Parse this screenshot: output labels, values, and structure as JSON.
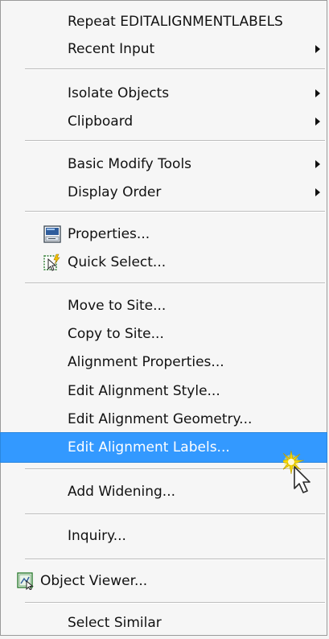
{
  "menu": {
    "items": [
      {
        "label": "Repeat EDITALIGNMENTLABELS"
      },
      {
        "label": "Recent Input"
      },
      {
        "label": "Isolate Objects"
      },
      {
        "label": "Clipboard"
      },
      {
        "label": "Basic Modify Tools"
      },
      {
        "label": "Display Order"
      },
      {
        "label": "Properties..."
      },
      {
        "label": "Quick Select..."
      },
      {
        "label": "Move to Site..."
      },
      {
        "label": "Copy to Site..."
      },
      {
        "label": "Alignment Properties..."
      },
      {
        "label": "Edit Alignment Style..."
      },
      {
        "label": "Edit Alignment Geometry..."
      },
      {
        "label": "Edit Alignment Labels..."
      },
      {
        "label": "Add Widening..."
      },
      {
        "label": "Inquiry..."
      },
      {
        "label": "Object Viewer..."
      },
      {
        "label": "Select Similar"
      }
    ]
  },
  "icons": {
    "properties": "properties-icon",
    "quick_select": "quick-select-icon",
    "object_viewer": "object-viewer-icon",
    "cursor": "mouse-pointer-icon"
  },
  "colors": {
    "highlight": "#3399ff",
    "menu_background": "#f6f6f6",
    "separator": "#bdbdbd"
  }
}
